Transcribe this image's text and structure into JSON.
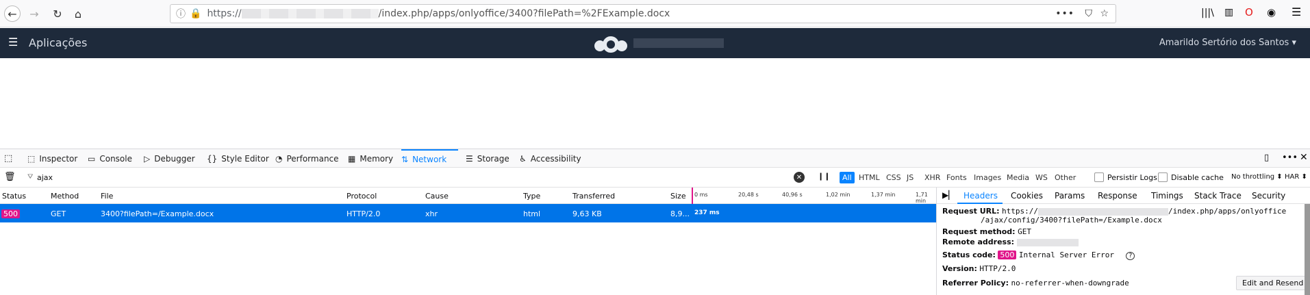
{
  "browser": {
    "url_prefix": "https://",
    "url_path": "/index.php/apps/onlyoffice/3400?filePath=%2FExample.docx"
  },
  "app": {
    "title": "Aplicações",
    "user": "Amarildo Sertório dos Santos"
  },
  "devtools": {
    "tabs": [
      "Inspector",
      "Console",
      "Debugger",
      "Style Editor",
      "Performance",
      "Memory",
      "Network",
      "Storage",
      "Accessibility"
    ],
    "filter_value": "ajax",
    "type_filters": [
      "All",
      "HTML",
      "CSS",
      "JS",
      "XHR",
      "Fonts",
      "Images",
      "Media",
      "WS",
      "Other"
    ],
    "persist_logs": "Persistir Logs",
    "disable_cache": "Disable cache",
    "throttling": "No throttling ⬍",
    "har": "HAR ⬍",
    "columns": [
      "Status",
      "Method",
      "File",
      "Protocol",
      "Cause",
      "Type",
      "Transferred",
      "Size"
    ],
    "timeline_ticks": [
      "0 ms",
      "20,48 s",
      "40,96 s",
      "1,02 min",
      "1,37 min",
      "1,71 min"
    ],
    "row": {
      "status": "500",
      "method": "GET",
      "file": "3400?filePath=/Example.docx",
      "protocol": "HTTP/2.0",
      "cause": "xhr",
      "type": "html",
      "transferred": "9,63 KB",
      "size": "8,9...",
      "time": "237 ms"
    },
    "panel_tabs": [
      "Headers",
      "Cookies",
      "Params",
      "Response",
      "Timings",
      "Stack Trace",
      "Security"
    ],
    "details": {
      "request_url_label": "Request URL:",
      "request_url_prefix": "https://",
      "request_url_rest": "/index.php/apps/onlyoffice",
      "request_url_line2": "/ajax/config/3400?filePath=/Example.docx",
      "method_label": "Request method:",
      "method": "GET",
      "remote_label": "Remote address:",
      "status_label": "Status code:",
      "status_code": "500",
      "status_text": "Internal Server Error",
      "version_label": "Version:",
      "version": "HTTP/2.0",
      "referrer_label": "Referrer Policy:",
      "referrer": "no-referrer-when-downgrade",
      "edit_resend": "Edit and Resend"
    }
  }
}
